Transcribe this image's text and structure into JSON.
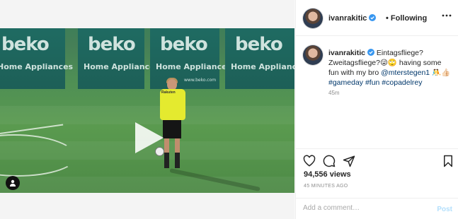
{
  "post": {
    "username": "ivanrakitic",
    "dot": "•",
    "following_label": "Following"
  },
  "caption": {
    "username": "ivanrakitic",
    "line1": "Eintagsfliege?",
    "line2": "Zweitagsfliege?😜🙄 having some",
    "line3_prefix": "fun with my bro ",
    "mention": "@mterstegen1",
    "emoji_tail": " 🤼👍🏻",
    "hashtags": "#gameday #fun #copadelrey",
    "time": "45m"
  },
  "stats": {
    "views": "94,556 views",
    "ago": "45 MINUTES AGO"
  },
  "comment": {
    "placeholder": "Add a comment…",
    "post_label": "Post"
  },
  "media": {
    "board_logo": "beko",
    "board_sub": "Home Appliances",
    "board_web": "www.beko.com",
    "shirt_text": "Rakuten"
  },
  "icons": {
    "more": "more-options-icon",
    "verified": "verified-badge-icon",
    "like": "heart-icon",
    "comment": "comment-icon",
    "share": "share-icon",
    "save": "bookmark-icon",
    "play": "play-icon",
    "tag": "user-tag-icon"
  },
  "colors": {
    "verified": "#3897f0",
    "link": "#00376b",
    "post_disabled": "#b2dffc",
    "muted": "#8e8e8e"
  }
}
